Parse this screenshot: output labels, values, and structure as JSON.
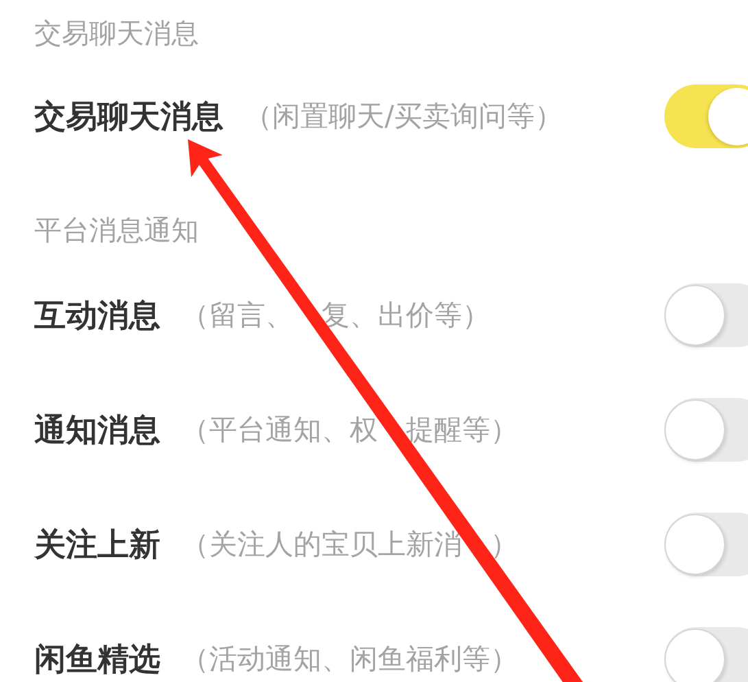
{
  "sections": [
    {
      "header": "交易聊天消息",
      "items": [
        {
          "title": "交易聊天消息",
          "subtitle": "（闲置聊天/买卖询问等）",
          "on": true
        }
      ]
    },
    {
      "header": "平台消息通知",
      "items": [
        {
          "title": "互动消息",
          "subtitle": "（留言、　复、出价等）",
          "on": false
        },
        {
          "title": "通知消息",
          "subtitle": "（平台通知、权　提醒等）",
          "on": false
        },
        {
          "title": "关注上新",
          "subtitle": "（关注人的宝贝上新消　）",
          "on": false
        },
        {
          "title": "闲鱼精选",
          "subtitle": "（活动通知、闲鱼福利等）",
          "on": false
        }
      ]
    }
  ]
}
